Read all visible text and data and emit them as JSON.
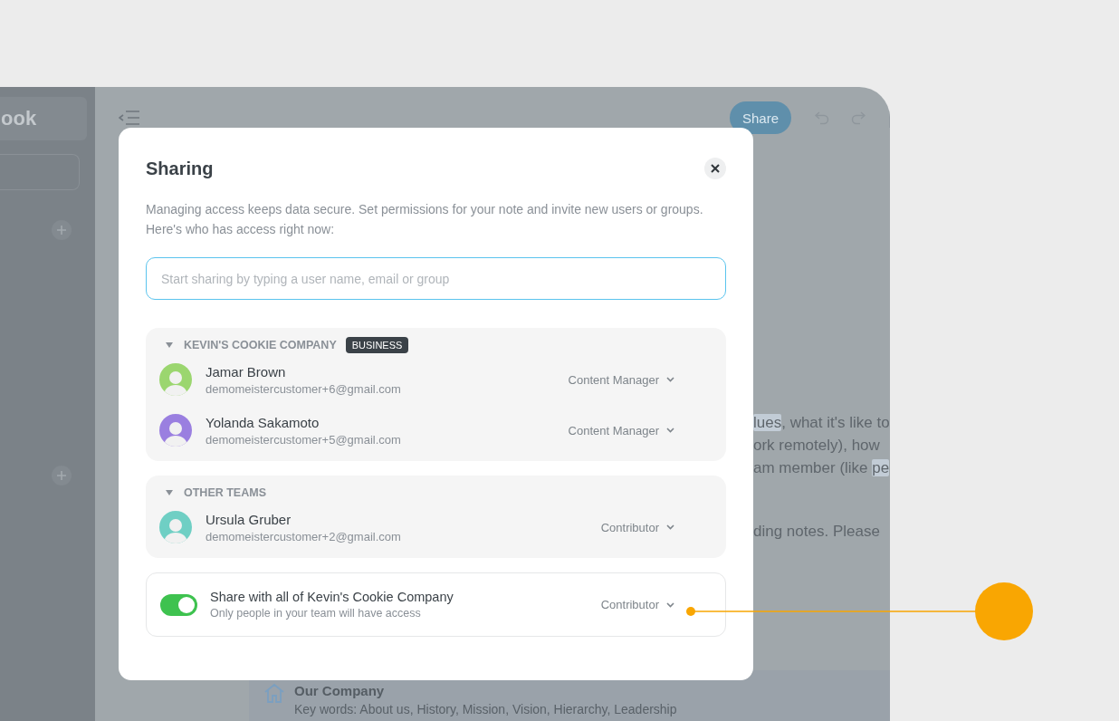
{
  "sidebar": {
    "title": "ook"
  },
  "toolbar": {
    "share_button": "Share"
  },
  "document": {
    "paragraphs": [
      [
        {
          "segments": [
            {
              "text": "lues",
              "highlighted": true
            },
            {
              "text": ", what it's like to",
              "highlighted": false
            }
          ]
        },
        {
          "segments": [
            {
              "text": "ork remotely), how",
              "highlighted": false
            }
          ]
        },
        {
          "segments": [
            {
              "text": "am member (like ",
              "highlighted": false
            },
            {
              "text": "pe",
              "highlighted": true
            }
          ]
        }
      ],
      [
        {
          "segments": [
            {
              "text": "ding notes. Please",
              "highlighted": false
            }
          ]
        }
      ]
    ]
  },
  "footer_card": {
    "title": "Our Company",
    "keywords": "Key words: About us, History, Mission, Vision, Hierarchy, Leadership"
  },
  "dialog": {
    "title": "Sharing",
    "description": "Managing access keeps data secure. Set permissions for your note and invite new users or groups. Here's who has access right now:",
    "search": {
      "placeholder": "Start sharing by typing a user name, email or group"
    },
    "groups": [
      {
        "name": "KEVIN'S COOKIE COMPANY",
        "badge": "BUSINESS",
        "expanded": true,
        "members": [
          {
            "name": "Jamar Brown",
            "email": "demomeistercustomer+6@gmail.com",
            "role": "Content Manager",
            "color": "#9bd66f"
          },
          {
            "name": "Yolanda Sakamoto",
            "email": "demomeistercustomer+5@gmail.com",
            "role": "Content Manager",
            "color": "#9a7fe0"
          }
        ]
      },
      {
        "name": "OTHER TEAMS",
        "expanded": true,
        "members": [
          {
            "name": "Ursula Gruber",
            "email": "demomeistercustomer+2@gmail.com",
            "role": "Contributor",
            "color": "#6fcfc4"
          }
        ]
      }
    ],
    "team_share": {
      "on": true,
      "label": "Share with all of Kevin's Cookie Company",
      "hint": "Only people in your team will have access",
      "role": "Contributor"
    }
  }
}
